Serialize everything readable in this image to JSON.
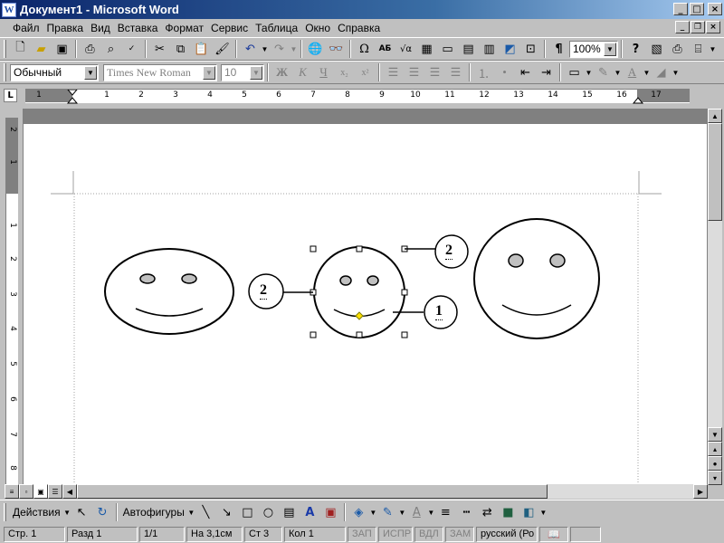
{
  "window": {
    "title": "Документ1 - Microsoft Word",
    "app_icon_letter": "W"
  },
  "menu": [
    {
      "label": "Файл"
    },
    {
      "label": "Правка"
    },
    {
      "label": "Вид"
    },
    {
      "label": "Вставка"
    },
    {
      "label": "Формат"
    },
    {
      "label": "Сервис"
    },
    {
      "label": "Таблица"
    },
    {
      "label": "Окно"
    },
    {
      "label": "Справка"
    }
  ],
  "standard_toolbar": {
    "buttons": [
      "new-document-icon",
      "open-folder-icon",
      "save-icon",
      "print-icon",
      "print-preview-icon",
      "spelling-icon",
      "cut-icon",
      "copy-icon",
      "paste-icon",
      "format-painter-icon",
      "undo-icon",
      "redo-icon",
      "hyperlink-icon",
      "find-icon",
      "symbol-icon",
      "insert-table-icon",
      "columns-icon",
      "drawing-icon",
      "document-map-icon",
      "show-formatting-icon",
      "zoom-combo",
      "help-icon"
    ],
    "zoom": "100%"
  },
  "formatting_toolbar": {
    "style": "Обычный",
    "font": "Times New Roman",
    "size": "10",
    "bold": "Ж",
    "italic": "К",
    "underline": "Ч"
  },
  "ruler": {
    "numbers": [
      "1",
      "1",
      "2",
      "3",
      "4",
      "5",
      "6",
      "7",
      "8",
      "9",
      "10",
      "11",
      "12",
      "13",
      "14",
      "15",
      "16",
      "17"
    ],
    "vertical_numbers": [
      "2",
      "1",
      "1",
      "2",
      "3",
      "4",
      "5",
      "6",
      "7",
      "8"
    ]
  },
  "drawing": {
    "callouts": [
      {
        "id": "left",
        "label": "2"
      },
      {
        "id": "top",
        "label": "2"
      },
      {
        "id": "bottom",
        "label": "1"
      }
    ]
  },
  "drawing_toolbar": {
    "actions_label": "Действия",
    "autoshapes_label": "Автофигуры"
  },
  "status": {
    "page": "Стр. 1",
    "section": "Разд 1",
    "pages": "1/1",
    "position": "На 3,1см",
    "line": "Ст 3",
    "column": "Кол 1",
    "rec": "ЗАП",
    "track": "ИСПР",
    "extend": "ВДЛ",
    "overtype": "ЗАМ",
    "language": "русский (Ро"
  },
  "colors": {
    "title_start": "#0a246a",
    "title_end": "#a6caf0",
    "eye_fill": "#c0c0c0",
    "handle_yellow": "#ffe000"
  }
}
